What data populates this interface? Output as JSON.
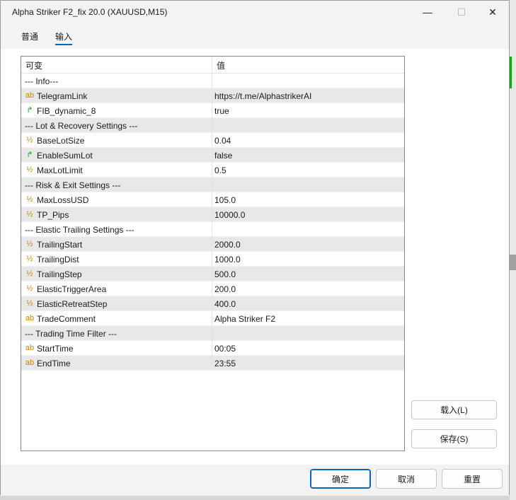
{
  "window": {
    "title": "Alpha Striker F2_fix 20.0 (XAUUSD,M15)",
    "minimize_glyph": "—",
    "maximize_glyph": "☐",
    "close_glyph": "✕"
  },
  "tabs": [
    {
      "label": "普通"
    },
    {
      "label": "输入",
      "selected": true
    }
  ],
  "grid": {
    "header": {
      "name": "可变",
      "value": "值"
    },
    "rows": [
      {
        "icon": "",
        "name": "--- Info---",
        "value": "",
        "section": true
      },
      {
        "icon": "string-icon",
        "glyph": "ab",
        "name": "TelegramLink",
        "value": "https://t.me/AlphastrikerAI"
      },
      {
        "icon": "bool-icon",
        "glyph": "↱",
        "name": "FIB_dynamic_8",
        "value": "true"
      },
      {
        "icon": "",
        "name": "--- Lot & Recovery Settings ---",
        "value": "",
        "section": true
      },
      {
        "icon": "number-icon",
        "glyph": "½",
        "name": "BaseLotSize",
        "value": "0.04"
      },
      {
        "icon": "bool-icon",
        "glyph": "↱",
        "name": "EnableSumLot",
        "value": "false"
      },
      {
        "icon": "number-icon",
        "glyph": "½",
        "name": "MaxLotLimit",
        "value": "0.5"
      },
      {
        "icon": "",
        "name": "--- Risk & Exit Settings ---",
        "value": "",
        "section": true
      },
      {
        "icon": "number-icon",
        "glyph": "½",
        "name": "MaxLossUSD",
        "value": "105.0"
      },
      {
        "icon": "number-icon",
        "glyph": "½",
        "name": "TP_Pips",
        "value": "10000.0"
      },
      {
        "icon": "",
        "name": "--- Elastic Trailing Settings ---",
        "value": "",
        "section": true
      },
      {
        "icon": "number-icon",
        "glyph": "½",
        "name": "TrailingStart",
        "value": "2000.0"
      },
      {
        "icon": "number-icon",
        "glyph": "½",
        "name": "TrailingDist",
        "value": "1000.0"
      },
      {
        "icon": "number-icon",
        "glyph": "½",
        "name": "TrailingStep",
        "value": "500.0"
      },
      {
        "icon": "number-icon",
        "glyph": "½",
        "name": "ElasticTriggerArea",
        "value": "200.0"
      },
      {
        "icon": "number-icon",
        "glyph": "½",
        "name": "ElasticRetreatStep",
        "value": "400.0"
      },
      {
        "icon": "string-icon",
        "glyph": "ab",
        "name": "TradeComment",
        "value": "Alpha Striker F2"
      },
      {
        "icon": "",
        "name": "--- Trading Time Filter ---",
        "value": "",
        "section": true
      },
      {
        "icon": "string-icon",
        "glyph": "ab",
        "name": "StartTime",
        "value": "00:05"
      },
      {
        "icon": "string-icon",
        "glyph": "ab",
        "name": "EndTime",
        "value": "23:55"
      }
    ]
  },
  "side_buttons": {
    "load": "载入(L)",
    "save": "保存(S)"
  },
  "footer": {
    "ok": "确定",
    "cancel": "取消",
    "reset": "重置"
  }
}
